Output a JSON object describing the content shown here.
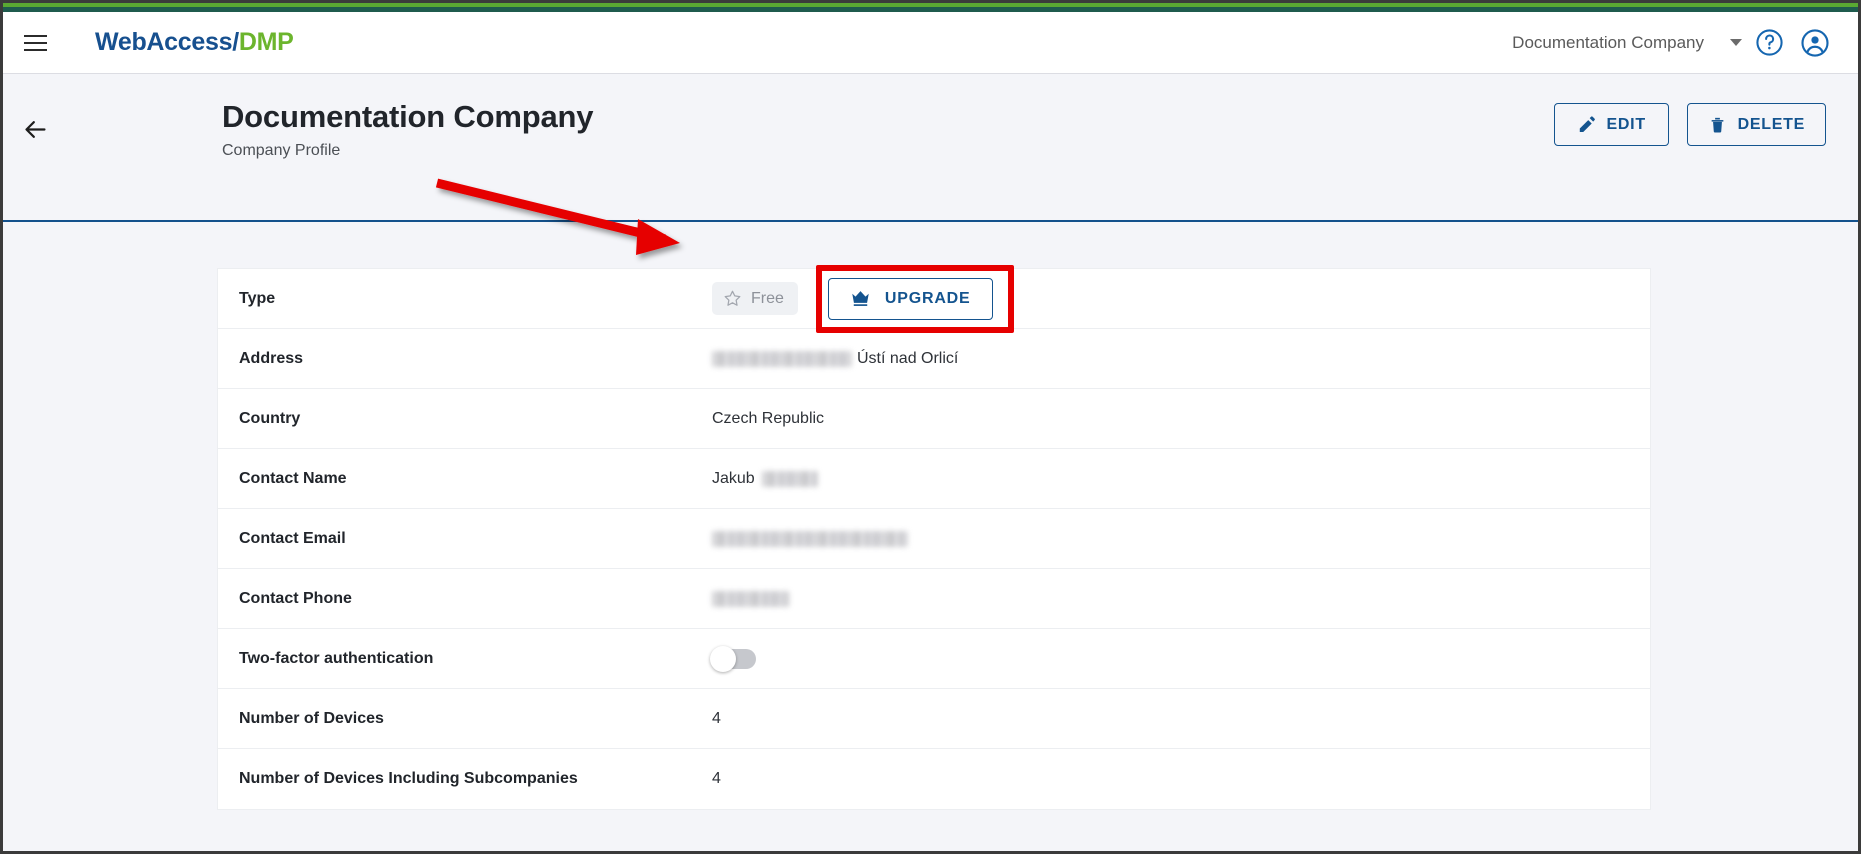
{
  "appbar": {
    "menu_icon": "hamburger-menu-icon",
    "brand_primary": "WebAccess/",
    "brand_secondary": "DMP",
    "company_selector": "Documentation Company",
    "caret_icon": "chevron-down-icon",
    "help_icon": "help-circle-icon",
    "account_icon": "account-circle-icon"
  },
  "page_header": {
    "back_icon": "arrow-left-icon",
    "title": "Documentation Company",
    "subtitle": "Company Profile",
    "edit_label": "EDIT",
    "edit_icon": "pencil-icon",
    "delete_label": "DELETE",
    "delete_icon": "trash-icon"
  },
  "profile": {
    "rows": [
      {
        "label": "Type",
        "value": "",
        "kind": "type"
      },
      {
        "label": "Address",
        "value": "Ústí nad Orlicí",
        "kind": "redacted-prefix"
      },
      {
        "label": "Country",
        "value": "Czech Republic",
        "kind": "text"
      },
      {
        "label": "Contact Name",
        "value": "Jakub",
        "kind": "redacted-suffix"
      },
      {
        "label": "Contact Email",
        "value": "",
        "kind": "redacted"
      },
      {
        "label": "Contact Phone",
        "value": "",
        "kind": "redacted"
      },
      {
        "label": "Two-factor authentication",
        "value": "off",
        "kind": "toggle"
      },
      {
        "label": "Number of Devices",
        "value": "4",
        "kind": "text"
      },
      {
        "label": "Number of Devices Including Subcompanies",
        "value": "4",
        "kind": "text"
      }
    ],
    "type_badge_label": "Free",
    "type_badge_icon": "star-icon",
    "upgrade_label": "UPGRADE",
    "upgrade_icon": "crown-icon"
  },
  "annotation": {
    "arrow_color": "#e60000",
    "highlight_color": "#e60000"
  },
  "colors": {
    "brand_blue": "#17508f",
    "brand_green": "#6cb52d",
    "accent_blue": "#14548f",
    "top_strip": "#1f5b4e",
    "page_bg": "#f4f5f9"
  }
}
